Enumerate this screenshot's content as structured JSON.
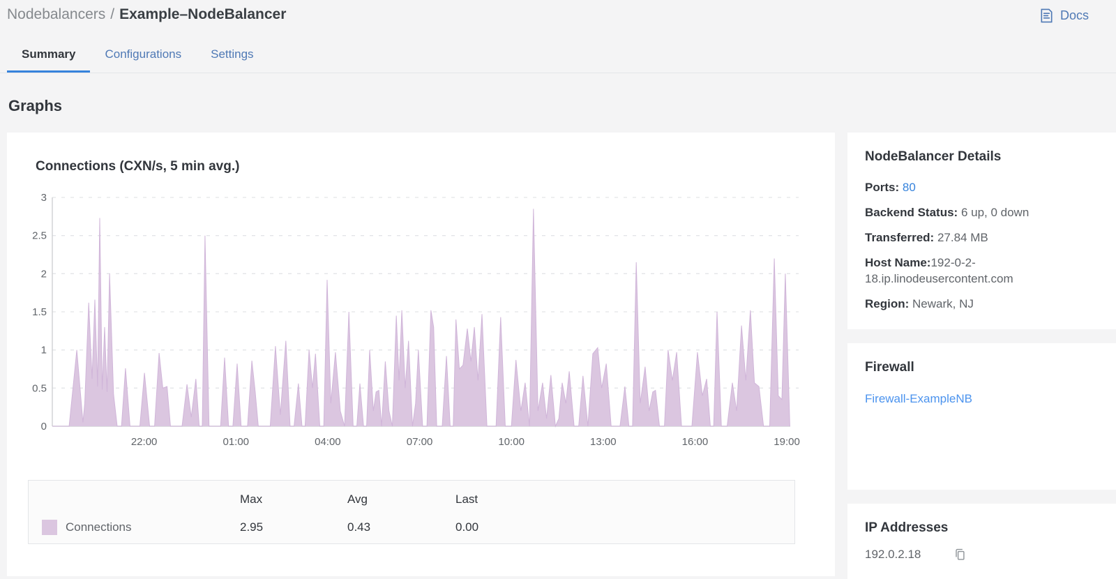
{
  "breadcrumb": {
    "section": "Nodebalancers",
    "separator": "/",
    "current": "Example–NodeBalancer"
  },
  "header": {
    "docs_label": "Docs",
    "docs_icon": "document-icon"
  },
  "tabs": [
    {
      "label": "Summary",
      "active": true
    },
    {
      "label": "Configurations",
      "active": false
    },
    {
      "label": "Settings",
      "active": false
    }
  ],
  "page_heading": "Graphs",
  "chart_card": {
    "title": "Connections (CXN/s, 5 min avg.)"
  },
  "chart_data": {
    "type": "area",
    "title": "Connections (CXN/s, 5 min avg.)",
    "xlabel": "",
    "ylabel": "",
    "ylim": [
      0,
      3
    ],
    "y_ticks": [
      "0",
      "0.5",
      "1",
      "1.5",
      "2",
      "2.5",
      "3"
    ],
    "x_range_hours": [
      0,
      24.5
    ],
    "x_ticks": [
      {
        "hour": 3,
        "label": "22:00"
      },
      {
        "hour": 6,
        "label": "01:00"
      },
      {
        "hour": 9,
        "label": "04:00"
      },
      {
        "hour": 12,
        "label": "07:00"
      },
      {
        "hour": 15,
        "label": "10:00"
      },
      {
        "hour": 18,
        "label": "13:00"
      },
      {
        "hour": 21,
        "label": "16:00"
      },
      {
        "hour": 24,
        "label": "19:00"
      }
    ],
    "grid": "horizontal-dashed",
    "legend_position": "bottom-table",
    "series": [
      {
        "name": "Connections",
        "fill_color": "#dbc6e0",
        "stroke_color": "#d0b5d9",
        "stats": {
          "max": 2.95,
          "avg": 0.43,
          "last": 0.0
        },
        "points": [
          [
            0,
            0
          ],
          [
            0.55,
            0
          ],
          [
            0.8,
            1.0
          ],
          [
            1.0,
            0.05
          ],
          [
            1.06,
            0.3
          ],
          [
            1.19,
            1.62
          ],
          [
            1.3,
            0.62
          ],
          [
            1.39,
            1.66
          ],
          [
            1.48,
            0.52
          ],
          [
            1.55,
            2.73
          ],
          [
            1.63,
            0.48
          ],
          [
            1.71,
            1.3
          ],
          [
            1.79,
            0.45
          ],
          [
            1.87,
            2.0
          ],
          [
            2.0,
            0.42
          ],
          [
            2.12,
            0
          ],
          [
            2.26,
            0
          ],
          [
            2.39,
            0.76
          ],
          [
            2.54,
            0
          ],
          [
            2.86,
            0
          ],
          [
            3.01,
            0.7
          ],
          [
            3.18,
            0
          ],
          [
            3.34,
            0
          ],
          [
            3.49,
            0.96
          ],
          [
            3.61,
            0.5
          ],
          [
            3.75,
            0.52
          ],
          [
            3.86,
            0
          ],
          [
            4.24,
            0
          ],
          [
            4.4,
            0.55
          ],
          [
            4.54,
            0.12
          ],
          [
            4.69,
            0.62
          ],
          [
            4.8,
            0
          ],
          [
            4.9,
            0
          ],
          [
            4.99,
            2.5
          ],
          [
            5.12,
            0
          ],
          [
            5.5,
            0
          ],
          [
            5.63,
            0.9
          ],
          [
            5.76,
            0
          ],
          [
            5.9,
            0
          ],
          [
            6.04,
            0.82
          ],
          [
            6.17,
            0
          ],
          [
            6.38,
            0
          ],
          [
            6.52,
            0.86
          ],
          [
            6.63,
            0.45
          ],
          [
            6.73,
            0
          ],
          [
            7.12,
            0
          ],
          [
            7.29,
            1.05
          ],
          [
            7.45,
            0.15
          ],
          [
            7.63,
            1.12
          ],
          [
            7.77,
            0
          ],
          [
            7.9,
            0
          ],
          [
            8.04,
            0.56
          ],
          [
            8.16,
            0
          ],
          [
            8.26,
            0
          ],
          [
            8.39,
            1.0
          ],
          [
            8.5,
            0.5
          ],
          [
            8.6,
            0.95
          ],
          [
            8.74,
            0
          ],
          [
            8.87,
            0
          ],
          [
            8.98,
            1.92
          ],
          [
            9.1,
            0.3
          ],
          [
            9.25,
            0.97
          ],
          [
            9.41,
            0.2
          ],
          [
            9.55,
            0
          ],
          [
            9.69,
            1.5
          ],
          [
            9.83,
            0
          ],
          [
            9.95,
            0
          ],
          [
            10.05,
            0.56
          ],
          [
            10.17,
            0
          ],
          [
            10.27,
            0
          ],
          [
            10.37,
            1.0
          ],
          [
            10.49,
            0.2
          ],
          [
            10.58,
            0.45
          ],
          [
            10.67,
            0.47
          ],
          [
            10.76,
            0
          ],
          [
            10.88,
            0.85
          ],
          [
            11.0,
            0.2
          ],
          [
            11.11,
            0
          ],
          [
            11.24,
            1.45
          ],
          [
            11.33,
            0.6
          ],
          [
            11.42,
            1.52
          ],
          [
            11.53,
            0.5
          ],
          [
            11.64,
            1.12
          ],
          [
            11.77,
            0
          ],
          [
            11.87,
            0.3
          ],
          [
            11.96,
            1.0
          ],
          [
            12.1,
            0
          ],
          [
            12.24,
            0
          ],
          [
            12.37,
            1.52
          ],
          [
            12.46,
            1.3
          ],
          [
            12.56,
            0
          ],
          [
            12.74,
            0
          ],
          [
            12.88,
            0.92
          ],
          [
            13.0,
            0
          ],
          [
            13.1,
            0
          ],
          [
            13.19,
            1.4
          ],
          [
            13.3,
            0.75
          ],
          [
            13.42,
            0.8
          ],
          [
            13.56,
            1.28
          ],
          [
            13.68,
            0.85
          ],
          [
            13.79,
            1.3
          ],
          [
            13.91,
            0.6
          ],
          [
            14.04,
            1.47
          ],
          [
            14.2,
            0
          ],
          [
            14.5,
            0
          ],
          [
            14.65,
            1.43
          ],
          [
            14.8,
            0
          ],
          [
            15.0,
            0
          ],
          [
            15.15,
            0.87
          ],
          [
            15.31,
            0.2
          ],
          [
            15.45,
            0.57
          ],
          [
            15.59,
            0
          ],
          [
            15.72,
            2.85
          ],
          [
            15.87,
            0.2
          ],
          [
            16.02,
            0.57
          ],
          [
            16.15,
            0.1
          ],
          [
            16.29,
            0.67
          ],
          [
            16.44,
            0
          ],
          [
            16.55,
            0.1
          ],
          [
            16.66,
            0.57
          ],
          [
            16.78,
            0.3
          ],
          [
            16.89,
            0.72
          ],
          [
            17.05,
            0
          ],
          [
            17.2,
            0
          ],
          [
            17.34,
            0.66
          ],
          [
            17.5,
            0
          ],
          [
            17.66,
            0.95
          ],
          [
            17.82,
            1.03
          ],
          [
            17.95,
            0.5
          ],
          [
            18.1,
            0.82
          ],
          [
            18.26,
            0
          ],
          [
            18.55,
            0
          ],
          [
            18.71,
            0.52
          ],
          [
            18.84,
            0
          ],
          [
            18.96,
            0
          ],
          [
            19.08,
            2.15
          ],
          [
            19.21,
            0.3
          ],
          [
            19.37,
            0.78
          ],
          [
            19.5,
            0.2
          ],
          [
            19.62,
            0.45
          ],
          [
            19.71,
            0.47
          ],
          [
            19.84,
            0
          ],
          [
            20.0,
            0
          ],
          [
            20.12,
            1.0
          ],
          [
            20.26,
            0.6
          ],
          [
            20.4,
            0.97
          ],
          [
            20.56,
            0
          ],
          [
            20.9,
            0
          ],
          [
            21.08,
            0.97
          ],
          [
            21.24,
            0.4
          ],
          [
            21.38,
            0.62
          ],
          [
            21.5,
            0
          ],
          [
            21.61,
            0
          ],
          [
            21.72,
            1.5
          ],
          [
            21.86,
            0
          ],
          [
            22.05,
            0
          ],
          [
            22.22,
            0.57
          ],
          [
            22.36,
            0.2
          ],
          [
            22.52,
            1.32
          ],
          [
            22.66,
            0.6
          ],
          [
            22.81,
            1.52
          ],
          [
            22.94,
            0.57
          ],
          [
            23.09,
            0.52
          ],
          [
            23.24,
            0
          ],
          [
            23.44,
            0
          ],
          [
            23.59,
            2.2
          ],
          [
            23.72,
            0.4
          ],
          [
            23.84,
            0.35
          ],
          [
            23.95,
            2.0
          ],
          [
            24.1,
            0
          ]
        ]
      }
    ]
  },
  "legend_table": {
    "columns": [
      "Max",
      "Avg",
      "Last"
    ],
    "rows": [
      {
        "name": "Connections",
        "swatch_color": "#dbc6e0",
        "max": "2.95",
        "avg": "0.43",
        "last": "0.00"
      }
    ]
  },
  "details_card": {
    "title": "NodeBalancer Details",
    "rows": [
      {
        "label": "Ports:",
        "sep": " ",
        "value": "80",
        "link": true
      },
      {
        "label": "Backend Status:",
        "sep": " ",
        "value": "6 up, 0 down",
        "link": false
      },
      {
        "label": "Transferred:",
        "sep": " ",
        "value": "27.84 MB",
        "link": false
      },
      {
        "label": "Host Name:",
        "sep": "",
        "value": "192-0-2-18.ip.linodeusercontent.com",
        "link": false
      },
      {
        "label": "Region:",
        "sep": " ",
        "value": "Newark, NJ",
        "link": false
      }
    ]
  },
  "firewall_card": {
    "title": "Firewall",
    "link_label": "Firewall-ExampleNB"
  },
  "ip_card": {
    "title": "IP Addresses",
    "ips": [
      "192.0.2.18"
    ],
    "copy_icon": "copy-icon"
  },
  "colors": {
    "page_bg": "#f4f4f5",
    "card_bg": "#ffffff",
    "text_dark": "#32363c",
    "text_gray": "#606469",
    "breadcrumb_gray": "#85898d",
    "accent_blue": "#3683dc",
    "tab_blue": "#4f79b5",
    "firewall_link_blue": "#4b93ee",
    "area_fill": "#dbc6e0",
    "grid_line": "#e3e5e8",
    "axis_line": "#d2d4d6"
  }
}
